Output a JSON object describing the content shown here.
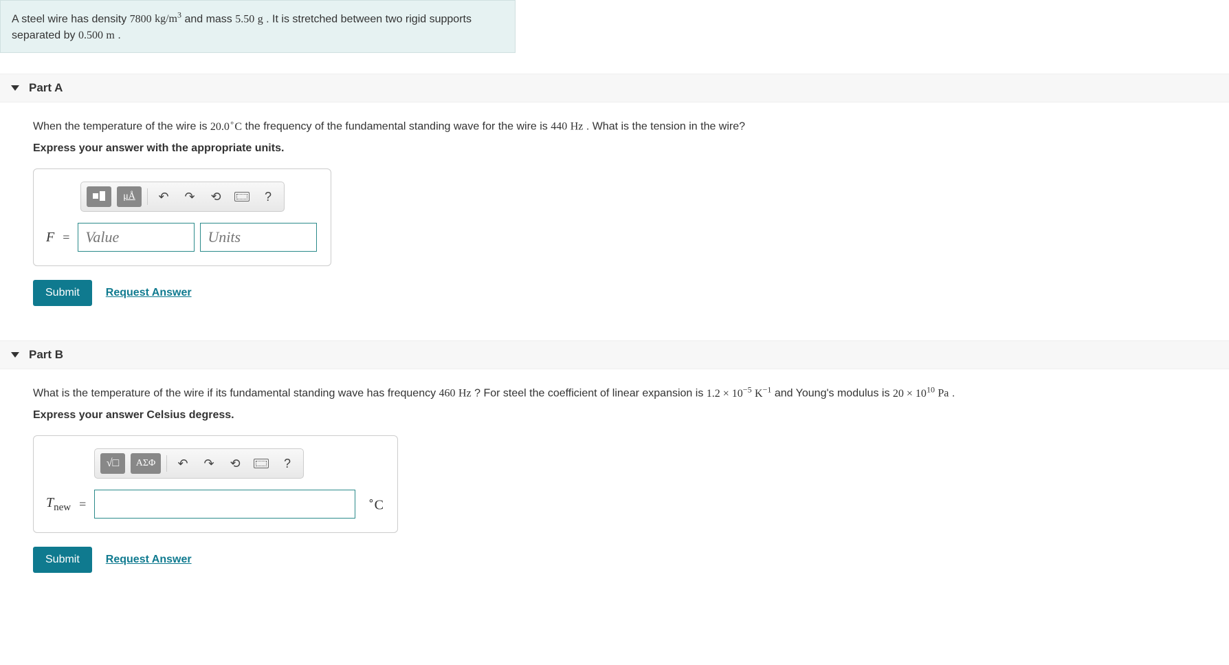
{
  "problem": {
    "text_prefix": "A steel wire has density ",
    "density": "7800",
    "density_units_prefix": "kg/m",
    "density_exp": "3",
    "text_mid1": " and mass ",
    "mass": "5.50",
    "mass_units": "g",
    "text_mid2": ". It is stretched between two rigid supports separated by ",
    "length": "0.500",
    "length_units": "m",
    "text_end": "."
  },
  "partA": {
    "title": "Part A",
    "question_prefix": "When the temperature of the wire is ",
    "temp": "20.0",
    "temp_deg": "∘",
    "temp_unit": "C",
    "question_mid": " the frequency of the fundamental standing wave for the wire is ",
    "freq": "440",
    "freq_unit": "Hz",
    "question_end": ". What is the tension in the wire?",
    "instruction": "Express your answer with the appropriate units.",
    "var": "F",
    "value_placeholder": "Value",
    "units_placeholder": "Units",
    "toolbar_units": "μÅ",
    "submit": "Submit",
    "request": "Request Answer"
  },
  "partB": {
    "title": "Part B",
    "question_prefix": "What is the temperature of the wire if its fundamental standing wave has frequency ",
    "freq": "460",
    "freq_unit": "Hz",
    "question_mid1": "? For steel the coefficient of linear expansion is ",
    "coef": "1.2 × 10",
    "coef_exp": "−5",
    "coef_unit_base": "K",
    "coef_unit_exp": "−1",
    "question_mid2": " and Young's modulus is ",
    "young": "20 × 10",
    "young_exp": "10",
    "young_unit": "Pa",
    "question_end": ".",
    "instruction": "Express your answer Celsius degress.",
    "var_base": "T",
    "var_sub": "new",
    "unit_suffix_deg": "∘",
    "unit_suffix": "C",
    "toolbar_greek": "ΑΣΦ",
    "submit": "Submit",
    "request": "Request Answer"
  },
  "icons": {
    "undo": "↶",
    "redo": "↷",
    "reset": "⟲",
    "help": "?"
  }
}
